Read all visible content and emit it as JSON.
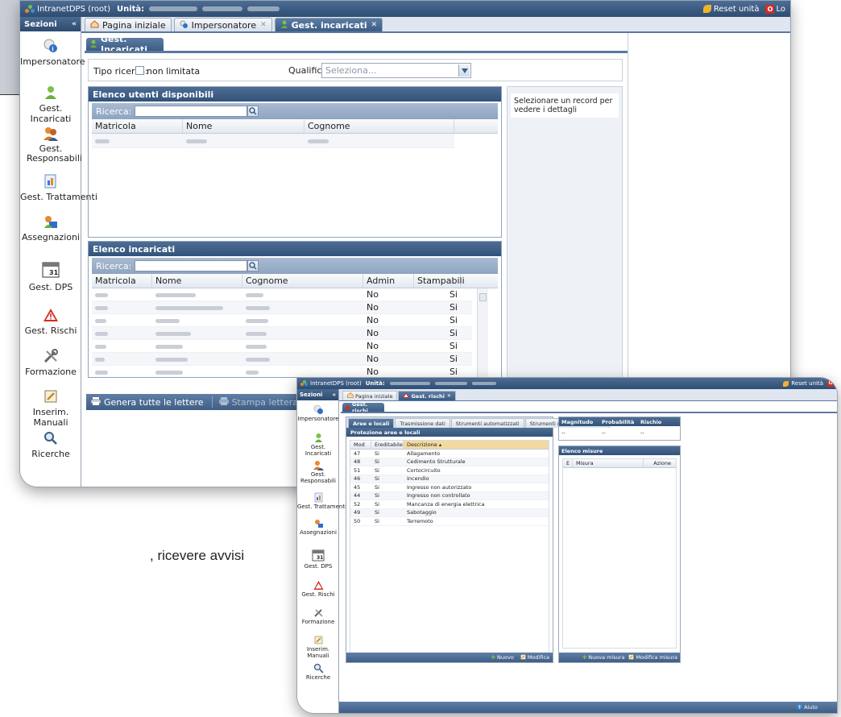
{
  "background": {
    "footer_text": ", ricevere avvisi"
  },
  "win1": {
    "app_title": "IntranetDPS (root)",
    "unit_label": "Unità:",
    "reset_label": "Reset unità",
    "logout_label": "Lo",
    "sidebar": {
      "title": "Sezioni",
      "items": [
        {
          "label": "Impersonatore",
          "icon": "impersonator-icon"
        },
        {
          "label": "Gest. Incaricati",
          "icon": "user-icon"
        },
        {
          "label": "Gest. Responsabili",
          "icon": "users-group-icon"
        },
        {
          "label": "Gest. Trattamenti",
          "icon": "document-chart-icon"
        },
        {
          "label": "Assegnazioni",
          "icon": "assign-icon"
        },
        {
          "label": "Gest. DPS",
          "icon": "calendar-icon"
        },
        {
          "label": "Gest. Rischi",
          "icon": "warning-icon"
        },
        {
          "label": "Formazione",
          "icon": "tools-icon"
        },
        {
          "label": "Inserim. Manuali",
          "icon": "edit-icon"
        },
        {
          "label": "Ricerche",
          "icon": "search-icon"
        }
      ]
    },
    "tabs": [
      {
        "label": "Pagina iniziale"
      },
      {
        "label": "Impersonatore"
      },
      {
        "label": "Gest. incaricati"
      }
    ],
    "subtab": "Gest. Incaricati",
    "filter": {
      "tipo_label": "Tipo ricerca:",
      "non_limitata_label": "non limitata",
      "qualifica_label": "Qualifica:",
      "qualifica_placeholder": "Seleziona..."
    },
    "available_panel": {
      "title": "Elenco utenti disponibili",
      "search_label": "Ricerca:",
      "columns": [
        "Matricola",
        "Nome",
        "Cognome"
      ]
    },
    "detail_text": "Selezionare un record per vedere i dettagli",
    "assigned_panel": {
      "title": "Elenco incaricati",
      "search_label": "Ricerca:",
      "columns": [
        "Matricola",
        "Nome",
        "Cognome",
        "Admin",
        "Stampabili"
      ],
      "rows": [
        {
          "admin": "No",
          "stampabili": "Si"
        },
        {
          "admin": "No",
          "stampabili": "Si"
        },
        {
          "admin": "No",
          "stampabili": "Si"
        },
        {
          "admin": "No",
          "stampabili": "Si"
        },
        {
          "admin": "No",
          "stampabili": "Si"
        },
        {
          "admin": "No",
          "stampabili": "Si"
        },
        {
          "admin": "No",
          "stampabili": "Si"
        }
      ]
    },
    "toolbar": {
      "generate_all": "Genera tutte le lettere",
      "print_letter": "Stampa lettera"
    }
  },
  "win2": {
    "app_title": "IntranetDPS (root)",
    "unit_label": "Unità:",
    "reset_label": "Reset unità",
    "sidebar_title": "Sezioni",
    "sidebar_items": [
      {
        "label": "Impersonatore"
      },
      {
        "label": "Gest. Incaricati"
      },
      {
        "label": "Gest. Responsabili"
      },
      {
        "label": "Gest. Trattamenti"
      },
      {
        "label": "Assegnazioni"
      },
      {
        "label": "Gest. DPS"
      },
      {
        "label": "Gest. Rischi"
      },
      {
        "label": "Formazione"
      },
      {
        "label": "Inserim. Manuali"
      },
      {
        "label": "Ricerche"
      }
    ],
    "tabs": [
      {
        "label": "Pagina iniziale"
      },
      {
        "label": "Gest. rischi"
      }
    ],
    "subtab": "Gest. rischi",
    "inner_tabs": [
      "Aree e locali",
      "Trasmissione dati",
      "Strumenti automatizzati",
      "Strumenti non automatizzati"
    ],
    "protection_title": "Protezione aree e locali",
    "columns": [
      "Mod",
      "Ereditabile",
      "Descrizione ▴"
    ],
    "rows": [
      {
        "mod": "47",
        "ered": "Si",
        "desc": "Allagamento"
      },
      {
        "mod": "48",
        "ered": "Si",
        "desc": "Cedimento Strutturale"
      },
      {
        "mod": "51",
        "ered": "Si",
        "desc": "Cortocircuito"
      },
      {
        "mod": "46",
        "ered": "Si",
        "desc": "Incendio"
      },
      {
        "mod": "45",
        "ered": "Si",
        "desc": "Ingresso non autorizzato"
      },
      {
        "mod": "44",
        "ered": "Si",
        "desc": "Ingresso non controllato"
      },
      {
        "mod": "52",
        "ered": "Si",
        "desc": "Mancanza di energia elettrica"
      },
      {
        "mod": "49",
        "ered": "Si",
        "desc": "Sabotaggio"
      },
      {
        "mod": "50",
        "ered": "Si",
        "desc": "Terremoto"
      }
    ],
    "left_toolbar": {
      "new": "Nuovo",
      "edit": "Modifica"
    },
    "risk_columns": [
      "Magnitudo",
      "Probabilità",
      "Rischio"
    ],
    "risk_values": [
      "--",
      "--",
      "--"
    ],
    "measures_title": "Elenco misure",
    "measure_columns": [
      "E",
      "Misura",
      "Azione"
    ],
    "right_toolbar": {
      "new": "Nuova misura",
      "edit": "Modifica misura"
    },
    "help_label": "Aiuto"
  }
}
